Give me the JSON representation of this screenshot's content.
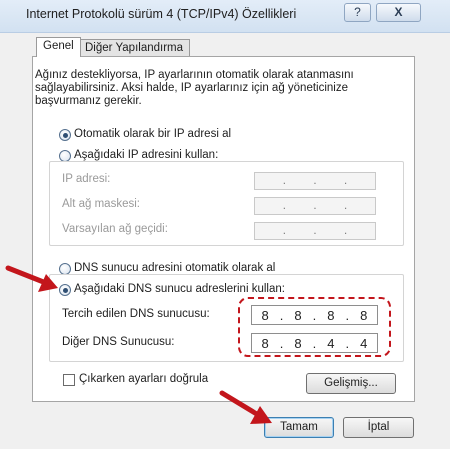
{
  "window": {
    "title": "Internet Protokolü sürüm 4 (TCP/IPv4) Özellikleri",
    "help_label": "?",
    "close_label": "X"
  },
  "tabs": [
    {
      "label": "Genel",
      "active": true
    },
    {
      "label": "Diğer Yapılandırma",
      "active": false
    }
  ],
  "intro_text": "Ağınız destekliyorsa, IP ayarlarının otomatik olarak atanmasını sağlayabilirsiniz. Aksi halde, IP ayarlarınız için ağ yöneticinize başvurmanız gerekir.",
  "ip_section": {
    "auto_label": "Otomatik olarak bir IP adresi al",
    "auto_selected": true,
    "manual_label": "Aşağıdaki IP adresini kullan:",
    "manual_selected": false,
    "fields": [
      {
        "label": "IP adresi:",
        "value": ". . ."
      },
      {
        "label": "Alt ağ maskesi:",
        "value": ". . ."
      },
      {
        "label": "Varsayılan ağ geçidi:",
        "value": ". . ."
      }
    ]
  },
  "dns_section": {
    "auto_label": "DNS sunucu adresini otomatik olarak al",
    "auto_selected": false,
    "manual_label": "Aşağıdaki DNS sunucu adreslerini kullan:",
    "manual_selected": true,
    "fields": [
      {
        "label": "Tercih edilen DNS sunucusu:",
        "octets": [
          "8",
          "8",
          "8",
          "8"
        ]
      },
      {
        "label": "Diğer DNS Sunucusu:",
        "octets": [
          "8",
          "8",
          "4",
          "4"
        ]
      }
    ]
  },
  "validate_label": "Çıkarken ayarları doğrula",
  "validate_checked": false,
  "advanced_label": "Gelişmiş...",
  "ok_label": "Tamam",
  "cancel_label": "İptal",
  "colors": {
    "annotation_red": "#c3161c"
  }
}
